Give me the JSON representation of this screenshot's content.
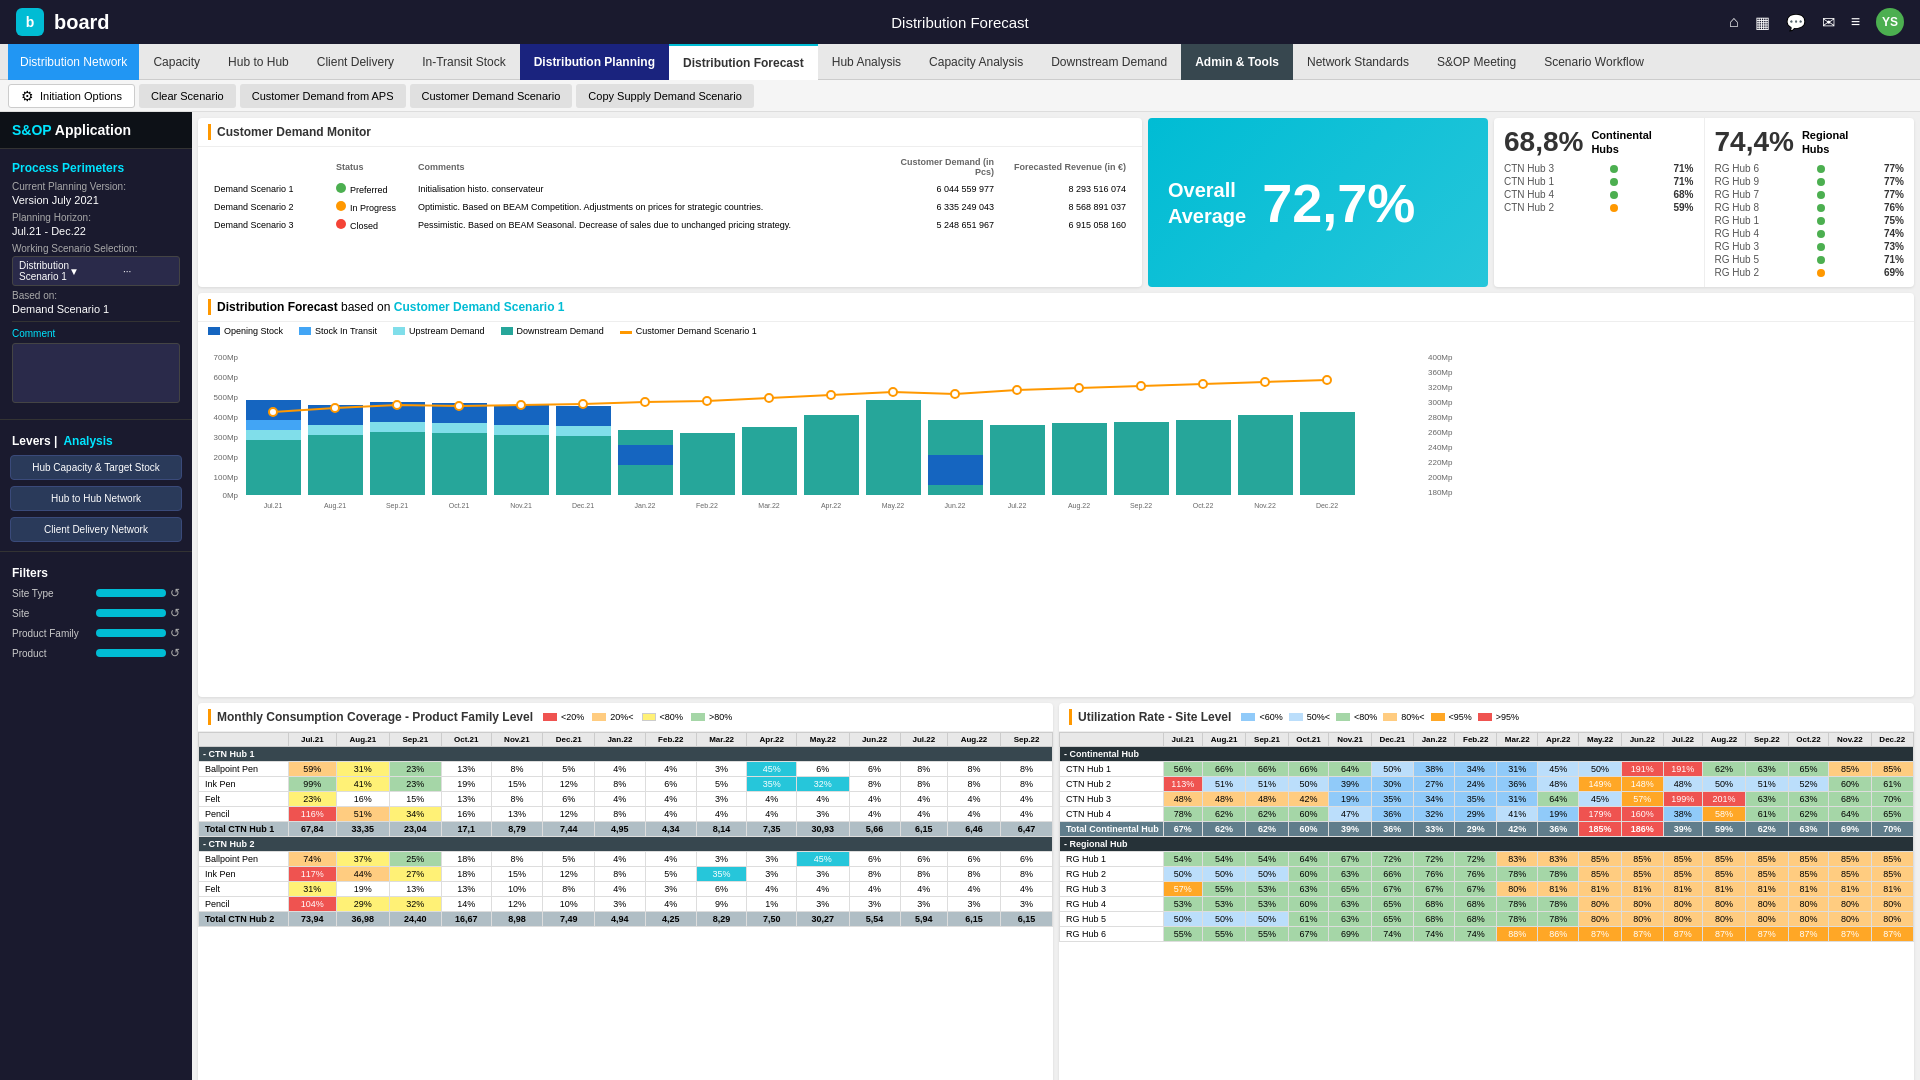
{
  "topbar": {
    "logo_icon": "b",
    "logo_text": "board",
    "title": "Distribution Forecast",
    "avatar": "YS"
  },
  "navbar": {
    "items": [
      {
        "label": "Distribution Network",
        "class": "nav-distribution-network"
      },
      {
        "label": "Capacity"
      },
      {
        "label": "Hub to Hub"
      },
      {
        "label": "Client Delivery"
      },
      {
        "label": "In-Transit Stock"
      },
      {
        "label": "Distribution Planning",
        "class": "nav-distribution-planning"
      },
      {
        "label": "Distribution Forecast",
        "active": true
      },
      {
        "label": "Hub Analysis"
      },
      {
        "label": "Capacity Analysis"
      },
      {
        "label": "Downstream Demand"
      },
      {
        "label": "Admin & Tools",
        "class": "nav-admin-tools"
      },
      {
        "label": "Network Standards"
      },
      {
        "label": "S&OP Meeting"
      },
      {
        "label": "Scenario Workflow"
      }
    ]
  },
  "subnav": {
    "items": [
      {
        "label": "Initiation Options",
        "active": true,
        "icon": "⚙"
      },
      {
        "label": "Clear Scenario"
      },
      {
        "label": "Customer Demand from APS"
      },
      {
        "label": "Customer Demand Scenario"
      },
      {
        "label": "Copy Supply Demand Scenario"
      }
    ]
  },
  "sidebar": {
    "app_title": "S&OP Application",
    "sections": {
      "process_perimeters": "Process Perimeters",
      "current_planning_version_label": "Current Planning Version:",
      "current_planning_version": "Version July 2021",
      "planning_horizon_label": "Planning Horizon:",
      "planning_horizon": "Jul.21 - Dec.22",
      "working_scenario_label": "Working Scenario Selection:",
      "working_scenario": "Distribution Scenario 1",
      "based_on_label": "Based on:",
      "based_on": "Demand Scenario 1",
      "comment_label": "Comment"
    },
    "levers": {
      "label": "Levers |",
      "analysis": "Analysis",
      "buttons": [
        "Hub Capacity & Target Stock",
        "Hub to Hub Network",
        "Client Delivery Network"
      ]
    },
    "filters": {
      "title": "Filters",
      "items": [
        "Site Type",
        "Site",
        "Product Family",
        "Product"
      ]
    }
  },
  "demand_monitor": {
    "title": "Customer Demand Monitor",
    "table": {
      "headers": [
        "",
        "Status",
        "Comments",
        "Customer Demand (in Pcs)",
        "Forecasted Revenue (in €)"
      ],
      "rows": [
        {
          "name": "Demand Scenario 1",
          "status": "Preferred",
          "status_color": "green",
          "comment": "Initialisation histo. conservateur",
          "demand": "6 044 559 977",
          "revenue": "8 293 516 074"
        },
        {
          "name": "Demand Scenario 2",
          "status": "In Progress",
          "status_color": "orange",
          "comment": "Optimistic. Based on BEAM Competition. Adjustments on prices for strategic countries.",
          "demand": "6 335 249 043",
          "revenue": "8 568 891 037"
        },
        {
          "name": "Demand Scenario 3",
          "status": "Closed",
          "status_color": "red",
          "comment": "Pessimistic. Based on BEAM Seasonal. Decrease of sales due to unchanged pricing strategy.",
          "demand": "5 248 651 967",
          "revenue": "6 915 058 160"
        }
      ]
    }
  },
  "overall": {
    "label": "Overall\nAverage",
    "value": "72,7%"
  },
  "continental_hubs": {
    "title": "Continental\nHubs",
    "percentage": "68,8%",
    "hubs": [
      {
        "name": "CTN Hub 3",
        "pct": "71%",
        "color": "green"
      },
      {
        "name": "CTN Hub 1",
        "pct": "71%",
        "color": "green"
      },
      {
        "name": "CTN Hub 4",
        "pct": "68%",
        "color": "green"
      },
      {
        "name": "CTN Hub 2",
        "pct": "59%",
        "color": "orange"
      }
    ]
  },
  "regional_hubs": {
    "title": "Regional\nHubs",
    "percentage": "74,4%",
    "hubs": [
      {
        "name": "RG Hub 6",
        "pct": "77%",
        "color": "green"
      },
      {
        "name": "RG Hub 9",
        "pct": "77%",
        "color": "green"
      },
      {
        "name": "RG Hub 7",
        "pct": "77%",
        "color": "green"
      },
      {
        "name": "RG Hub 8",
        "pct": "76%",
        "color": "green"
      },
      {
        "name": "RG Hub 1",
        "pct": "75%",
        "color": "green"
      },
      {
        "name": "RG Hub 4",
        "pct": "74%",
        "color": "green"
      },
      {
        "name": "RG Hub 3",
        "pct": "73%",
        "color": "green"
      },
      {
        "name": "RG Hub 5",
        "pct": "71%",
        "color": "green"
      },
      {
        "name": "RG Hub 2",
        "pct": "69%",
        "color": "orange"
      }
    ]
  },
  "distribution_forecast": {
    "title": "Distribution Forecast",
    "subtitle": "based on",
    "highlight": "Customer Demand Scenario 1",
    "legend": [
      {
        "label": "Opening Stock",
        "color": "#1565c0"
      },
      {
        "label": "Stock in Transit",
        "color": "#42a5f5"
      },
      {
        "label": "Upstream Demand",
        "color": "#80deea"
      },
      {
        "label": "Downstream Demand",
        "color": "#26a69a"
      },
      {
        "label": "Customer Demand Scenario 1",
        "color": "#ff9800"
      }
    ]
  },
  "monthly_coverage": {
    "title": "Monthly Consumption Coverage - Product Family Level",
    "legend": [
      {
        "label": "<20%",
        "color": "#ef5350"
      },
      {
        "label": "20%<",
        "color": "#ffcc80"
      },
      {
        "label": "<80%",
        "color": "#fff176"
      },
      {
        "label": ">80%",
        "color": "#a5d6a7"
      }
    ],
    "months": [
      "Jul.21",
      "Aug.21",
      "Sep.21",
      "Oct.21",
      "Nov.21",
      "Dec.21",
      "Jan.22",
      "Feb.22",
      "Mar.22",
      "Apr.22",
      "May.22",
      "Jun.22",
      "Jul.22",
      "Aug.22",
      "Sep.22"
    ],
    "sections": [
      {
        "header": "- CTN Hub 1",
        "rows": [
          {
            "name": "Ballpoint Pen",
            "values": [
              "59%",
              "31%",
              "23%",
              "13%",
              "8%",
              "5%",
              "4%",
              "4%",
              "3%",
              "45%",
              "6%",
              "6%",
              "8%",
              "8%",
              "8%"
            ],
            "highlights": [
              2,
              9
            ]
          },
          {
            "name": "Ink Pen",
            "values": [
              "99%",
              "41%",
              "23%",
              "19%",
              "15%",
              "12%",
              "8%",
              "6%",
              "5%",
              "35%",
              "32%",
              "8%",
              "8%",
              "8%",
              "8%"
            ],
            "highlights": [
              9,
              10
            ]
          },
          {
            "name": "Felt",
            "values": [
              "23%",
              "16%",
              "15%",
              "13%",
              "8%",
              "6%",
              "4%",
              "4%",
              "3%",
              "4%",
              "4%",
              "4%",
              "4%",
              "4%",
              "4%"
            ]
          },
          {
            "name": "Pencil",
            "values": [
              "116%",
              "51%",
              "34%",
              "16%",
              "13%",
              "12%",
              "8%",
              "4%",
              "4%",
              "4%",
              "3%",
              "4%",
              "4%",
              "4%",
              "4%"
            ],
            "highlights": [
              0
            ]
          },
          {
            "name": "Total CTN Hub 1",
            "total": true,
            "values": [
              "67,84",
              "33,35",
              "23,04",
              "17,1",
              "8,79",
              "7,44",
              "4,95",
              "4,34",
              "8,14",
              "7,35",
              "30,93",
              "5,66",
              "6,15",
              "6,46",
              "6,47"
            ]
          }
        ]
      },
      {
        "header": "- CTN Hub 2",
        "rows": [
          {
            "name": "Ballpoint Pen",
            "values": [
              "74%",
              "37%",
              "25%",
              "18%",
              "8%",
              "5%",
              "4%",
              "4%",
              "3%",
              "3%",
              "45%",
              "6%",
              "6%",
              "6%",
              "6%"
            ],
            "highlights": [
              10
            ]
          },
          {
            "name": "Ink Pen",
            "values": [
              "117%",
              "44%",
              "27%",
              "18%",
              "15%",
              "12%",
              "8%",
              "5%",
              "35%",
              "3%",
              "3%",
              "8%",
              "8%",
              "8%",
              "8%"
            ],
            "highlights": [
              0,
              8
            ]
          },
          {
            "name": "Felt",
            "values": [
              "31%",
              "19%",
              "13%",
              "13%",
              "10%",
              "8%",
              "4%",
              "3%",
              "6%",
              "4%",
              "4%",
              "4%",
              "4%",
              "4%",
              "4%"
            ]
          },
          {
            "name": "Pencil",
            "values": [
              "104%",
              "29%",
              "32%",
              "14%",
              "12%",
              "10%",
              "3%",
              "4%",
              "9%",
              "1%",
              "3%",
              "3%",
              "3%",
              "3%",
              "3%"
            ],
            "highlights": [
              0
            ]
          },
          {
            "name": "Total CTN Hub 2",
            "total": true,
            "values": [
              "73,94",
              "36,98",
              "24,40",
              "16,67",
              "8,98",
              "7,49",
              "4,94",
              "4,25",
              "8,29",
              "7,50",
              "30,27",
              "5,54",
              "5,94",
              "6,15",
              "6,15"
            ]
          }
        ]
      }
    ]
  },
  "utilization_rate": {
    "title": "Utilization Rate - Site Level",
    "legend": [
      {
        "label": "<60%",
        "color": "#90caf9"
      },
      {
        "label": "50%<",
        "color": "#bbdefb"
      },
      {
        "label": "<80%",
        "color": "#a5d6a7"
      },
      {
        "label": "80%<",
        "color": "#ffcc80"
      },
      {
        "label": "<95%",
        "color": "#ffa726"
      },
      {
        "label": ">95%",
        "color": "#ef5350"
      }
    ],
    "months": [
      "Jul.21",
      "Aug.21",
      "Sep.21",
      "Oct.21",
      "Nov.21",
      "Dec.21",
      "Jan.22",
      "Feb.22",
      "Mar.22",
      "Apr.22",
      "May.22",
      "Jun.22",
      "Jul.22",
      "Aug.22",
      "Sep.22",
      "Oct.22",
      "Nov.22",
      "Dec.22"
    ],
    "sections": [
      {
        "header": "- Continental Hub",
        "rows": [
          {
            "name": "CTN Hub 1",
            "values": [
              "56%",
              "66%",
              "66%",
              "66%",
              "64%",
              "50%",
              "38%",
              "34%",
              "31%",
              "45%",
              "50%",
              "191%",
              "191%",
              "62%",
              "63%",
              "65%",
              "85%",
              "85%"
            ]
          },
          {
            "name": "CTN Hub 2",
            "values": [
              "113%",
              "51%",
              "51%",
              "50%",
              "39%",
              "30%",
              "27%",
              "24%",
              "36%",
              "48%",
              "149%",
              "148%",
              "48%",
              "50%",
              "51%",
              "52%",
              "60%",
              "61%"
            ]
          },
          {
            "name": "CTN Hub 3",
            "values": [
              "48%",
              "48%",
              "48%",
              "42%",
              "19%",
              "35%",
              "34%",
              "35%",
              "31%",
              "64%",
              "45%",
              "57%",
              "199%",
              "201%",
              "63%",
              "63%",
              "68%",
              "70%"
            ]
          },
          {
            "name": "CTN Hub 4",
            "values": [
              "78%",
              "62%",
              "62%",
              "60%",
              "47%",
              "36%",
              "32%",
              "29%",
              "41%",
              "19%",
              "179%",
              "160%",
              "38%",
              "58%",
              "61%",
              "62%",
              "64%",
              "65%"
            ]
          },
          {
            "name": "Total Continental Hub",
            "total": true,
            "values": [
              "67%",
              "62%",
              "62%",
              "60%",
              "39%",
              "36%",
              "33%",
              "29%",
              "42%",
              "36%",
              "185%",
              "186%",
              "39%",
              "59%",
              "62%",
              "63%",
              "69%",
              "70%"
            ]
          }
        ]
      },
      {
        "header": "- Regional Hub",
        "rows": [
          {
            "name": "RG Hub 1",
            "values": [
              "54%",
              "54%",
              "54%",
              "64%",
              "67%",
              "72%",
              "72%",
              "72%",
              "83%",
              "83%",
              "85%",
              "85%",
              "85%",
              "85%",
              "85%",
              "85%",
              "85%",
              "85%"
            ]
          },
          {
            "name": "RG Hub 2",
            "values": [
              "50%",
              "50%",
              "50%",
              "60%",
              "63%",
              "66%",
              "76%",
              "76%",
              "78%",
              "78%",
              "85%",
              "85%",
              "85%",
              "85%",
              "85%",
              "85%",
              "85%",
              "85%"
            ]
          },
          {
            "name": "RG Hub 3",
            "values": [
              "57%",
              "55%",
              "53%",
              "63%",
              "65%",
              "67%",
              "67%",
              "67%",
              "80%",
              "81%",
              "81%",
              "81%",
              "81%",
              "81%",
              "81%",
              "81%",
              "81%",
              "81%"
            ]
          },
          {
            "name": "RG Hub 4",
            "values": [
              "53%",
              "53%",
              "53%",
              "60%",
              "63%",
              "65%",
              "68%",
              "68%",
              "78%",
              "78%",
              "80%",
              "80%",
              "80%",
              "80%",
              "80%",
              "80%",
              "80%",
              "80%"
            ]
          },
          {
            "name": "RG Hub 5",
            "values": [
              "50%",
              "50%",
              "50%",
              "61%",
              "63%",
              "65%",
              "68%",
              "68%",
              "78%",
              "78%",
              "80%",
              "80%",
              "80%",
              "80%",
              "80%",
              "80%",
              "80%",
              "80%"
            ]
          },
          {
            "name": "RG Hub 6",
            "values": [
              "55%",
              "55%",
              "55%",
              "67%",
              "69%",
              "74%",
              "74%",
              "74%",
              "88%",
              "86%",
              "87%",
              "87%",
              "87%",
              "87%",
              "87%",
              "87%",
              "87%",
              "87%"
            ]
          }
        ]
      }
    ]
  }
}
